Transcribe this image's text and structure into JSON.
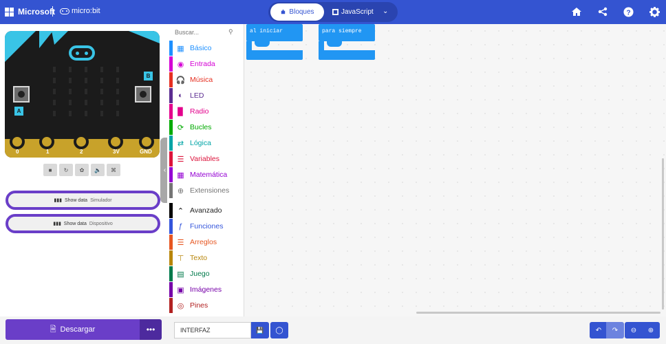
{
  "header": {
    "brand": "Microsoft",
    "product": "micro:bit",
    "tabs": [
      {
        "label": "Bloques",
        "active": true
      },
      {
        "label": "JavaScript",
        "active": false
      }
    ],
    "icons": [
      "home-icon",
      "share-icon",
      "help-icon",
      "settings-icon"
    ],
    "color": "#3454d1"
  },
  "simulator": {
    "pins": [
      "0",
      "1",
      "2",
      "3V",
      "GND"
    ],
    "button_labels": {
      "a": "A",
      "b": "B"
    },
    "tools": [
      "stop-icon",
      "restart-icon",
      "debug-icon",
      "sound-icon",
      "fullscreen-icon"
    ],
    "show_data": [
      {
        "label": "Show data",
        "sub": "Simulador"
      },
      {
        "label": "Show data",
        "sub": "Dispositivo"
      }
    ]
  },
  "toolbox": {
    "search_placeholder": "Buscar...",
    "categories": [
      {
        "label": "Básico",
        "color": "#1e90ff",
        "icon": "grid"
      },
      {
        "label": "Entrada",
        "color": "#d400d4",
        "icon": "circle"
      },
      {
        "label": "Música",
        "color": "#e63022",
        "icon": "headphones"
      },
      {
        "label": "LED",
        "color": "#5c2d91",
        "icon": "toggle"
      },
      {
        "label": "Radio",
        "color": "#e3008c",
        "icon": "signal"
      },
      {
        "label": "Bucles",
        "color": "#00aa00",
        "icon": "refresh"
      },
      {
        "label": "Lógica",
        "color": "#00a4a6",
        "icon": "shuffle"
      },
      {
        "label": "Variables",
        "color": "#dc143c",
        "icon": "list"
      },
      {
        "label": "Matemática",
        "color": "#9400d3",
        "icon": "calculator"
      },
      {
        "label": "Extensiones",
        "color": "#757575",
        "icon": "plus"
      },
      {
        "label": "Avanzado",
        "color": "#000000",
        "icon": "chevron-up"
      },
      {
        "label": "Funciones",
        "color": "#3455db",
        "icon": "function"
      },
      {
        "label": "Arreglos",
        "color": "#e65722",
        "icon": "array"
      },
      {
        "label": "Texto",
        "color": "#b8860b",
        "icon": "text"
      },
      {
        "label": "Juego",
        "color": "#007a4b",
        "icon": "gamepad"
      },
      {
        "label": "Imágenes",
        "color": "#7600a8",
        "icon": "image"
      },
      {
        "label": "Pines",
        "color": "#b22222",
        "icon": "pin"
      }
    ]
  },
  "workspace": {
    "blocks": [
      {
        "label": "al iniciar"
      },
      {
        "label": "para siempre"
      }
    ]
  },
  "footer": {
    "download_label": "Descargar",
    "more_label": "•••",
    "project_name": "INTERFAZ",
    "controls": [
      "undo-icon",
      "redo-icon",
      "zoom-out-icon",
      "zoom-in-icon"
    ]
  }
}
